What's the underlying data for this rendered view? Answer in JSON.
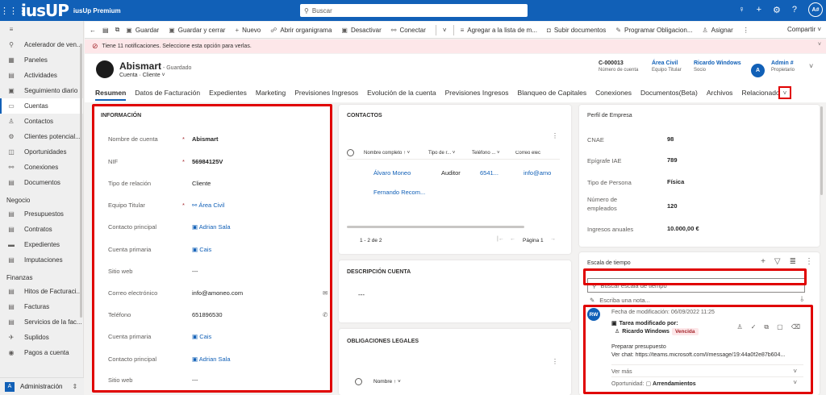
{
  "topbar": {
    "logo": "iusUP",
    "app": "iusUp Premium",
    "search": "Buscar",
    "user": "A#"
  },
  "sidebar": {
    "items": [
      {
        "icon": "⚲",
        "label": "Acelerador de ven..."
      },
      {
        "icon": "▦",
        "label": "Paneles"
      },
      {
        "icon": "▤",
        "label": "Actividades"
      },
      {
        "icon": "▣",
        "label": "Seguimiento diario"
      },
      {
        "icon": "▭",
        "label": "Cuentas",
        "active": true
      },
      {
        "icon": "♙",
        "label": "Contactos"
      },
      {
        "icon": "⚙",
        "label": "Clientes potencial..."
      },
      {
        "icon": "◫",
        "label": "Oportunidades"
      },
      {
        "icon": "⚯",
        "label": "Conexiones"
      },
      {
        "icon": "▤",
        "label": "Documentos"
      }
    ],
    "section_negocio": "Negocio",
    "negocio": [
      {
        "icon": "▤",
        "label": "Presupuestos"
      },
      {
        "icon": "▤",
        "label": "Contratos"
      },
      {
        "icon": "▬",
        "label": "Expedientes"
      },
      {
        "icon": "▤",
        "label": "Imputaciones"
      }
    ],
    "section_finanzas": "Finanzas",
    "finanzas": [
      {
        "icon": "▤",
        "label": "Hitos de Facturaci..."
      },
      {
        "icon": "▤",
        "label": "Facturas"
      },
      {
        "icon": "▤",
        "label": "Servicios de la fac..."
      },
      {
        "icon": "✈",
        "label": "Suplidos"
      },
      {
        "icon": "◉",
        "label": "Pagos a cuenta"
      }
    ],
    "area": {
      "badge": "A",
      "label": "Administración"
    }
  },
  "cmdbar": {
    "items": [
      {
        "icon": "▣",
        "label": "Guardar"
      },
      {
        "icon": "▣",
        "label": "Guardar y cerrar"
      },
      {
        "icon": "+",
        "label": "Nuevo"
      },
      {
        "icon": "☍",
        "label": "Abrir organigrama"
      },
      {
        "icon": "▣",
        "label": "Desactivar"
      },
      {
        "icon": "⚯",
        "label": "Conectar"
      },
      {
        "icon": "≡",
        "label": "Agregar a la lista de m..."
      },
      {
        "icon": "◘",
        "label": "Subir documentos"
      },
      {
        "icon": "✎",
        "label": "Programar Obligacion..."
      },
      {
        "icon": "♙",
        "label": "Asignar"
      }
    ],
    "share": "Compartir"
  },
  "notification": "Tiene 11 notificaciones. Seleccione esta opción para verlas.",
  "header": {
    "name": "Abismart",
    "saved": " - Guardado",
    "type": "Cuenta · Cliente",
    "fields": [
      {
        "value": "C-000013",
        "label": "Número de cuenta"
      },
      {
        "value": "Área Civil",
        "label": "Equipo Titular"
      },
      {
        "value": "Ricardo Windows",
        "label": "Socio"
      }
    ],
    "owner": {
      "initial": "A",
      "value": "Admin #",
      "label": "Propietario"
    }
  },
  "tabs": [
    "Resumen",
    "Datos de Facturación",
    "Expedientes",
    "Marketing",
    "Previsiones Ingresos",
    "Evolución de la cuenta",
    "Previsiones Ingresos",
    "Blanqueo de Capitales",
    "Conexiones",
    "Documentos(Beta)",
    "Archivos",
    "Relacionado"
  ],
  "info": {
    "title": "INFORMACIÓN",
    "rows": [
      {
        "label": "Nombre de cuenta",
        "req": "*",
        "value": "Abismart",
        "bold": true
      },
      {
        "label": "NIF",
        "req": "*",
        "value": "56984125V",
        "bold": true
      },
      {
        "label": "Tipo de relación",
        "value": "Cliente"
      },
      {
        "label": "Equipo Titular",
        "req": "*",
        "icon": "⚯",
        "value": "Área Civil",
        "link": true
      },
      {
        "label": "Contacto principal",
        "icon": "▣",
        "value": "Adrian Sala",
        "link": true
      },
      {
        "label": "Cuenta primaria",
        "icon": "▣",
        "value": "Cais",
        "link": true
      },
      {
        "label": "Sitio web",
        "value": "---"
      },
      {
        "label": "Correo electrónico",
        "value": "info@amoneo.com",
        "act": "✉"
      },
      {
        "label": "Teléfono",
        "value": "651896530",
        "act": "✆"
      },
      {
        "label": "Cuenta primaria",
        "icon": "▣",
        "value": "Cais",
        "link": true
      },
      {
        "label": "Contacto principal",
        "icon": "▣",
        "value": "Adrian Sala",
        "link": true
      },
      {
        "label": "Sitio web",
        "value": "---"
      }
    ]
  },
  "contacts": {
    "title": "CONTACTOS",
    "columns": [
      "Nombre completo ↑ ˅",
      "Tipo de r... ˅",
      "Teléfono ... ˅",
      "Correo elec"
    ],
    "rows": [
      {
        "name": "Álvaro Moneo",
        "type": "Auditor",
        "phone": "6541...",
        "email": "info@amo"
      },
      {
        "name": "Fernando Recom...",
        "type": "",
        "phone": "",
        "email": ""
      }
    ],
    "pager": "1 - 2 de 2",
    "page": "Página 1"
  },
  "description": {
    "title": "DESCRIPCIÓN CUENTA",
    "value": "---"
  },
  "obligations": {
    "title": "OBLIGACIONES LEGALES",
    "column": "Nombre ↑ ˅"
  },
  "profile": {
    "title": "Perfil de Empresa",
    "rows": [
      {
        "label": "CNAE",
        "value": "98"
      },
      {
        "label": "Epígrafe IAE",
        "value": "789"
      },
      {
        "label": "Tipo de Persona",
        "value": "Física"
      },
      {
        "label": "Número de empleados",
        "value": "120"
      },
      {
        "label": "Ingresos anuales",
        "value": "10.000,00 €"
      }
    ]
  },
  "timeline": {
    "title": "Escala de tiempo",
    "search": "Buscar escala de tiempo",
    "note": "Escriba una nota...",
    "post": {
      "initials": "RW",
      "date": "Fecha de modificación: 06/09/2022 11:25",
      "task": "Tarea modificado por:",
      "author": "Ricardo Windows",
      "status": "Vencida",
      "subject": "Preparar presupuesto",
      "body": "Ver chat: https://teams.microsoft.com/l/message/19:44a0f2e87b604...",
      "more": "Ver más",
      "regarding_label": "Oportunidad:",
      "regarding": "Arrendamientos"
    }
  }
}
